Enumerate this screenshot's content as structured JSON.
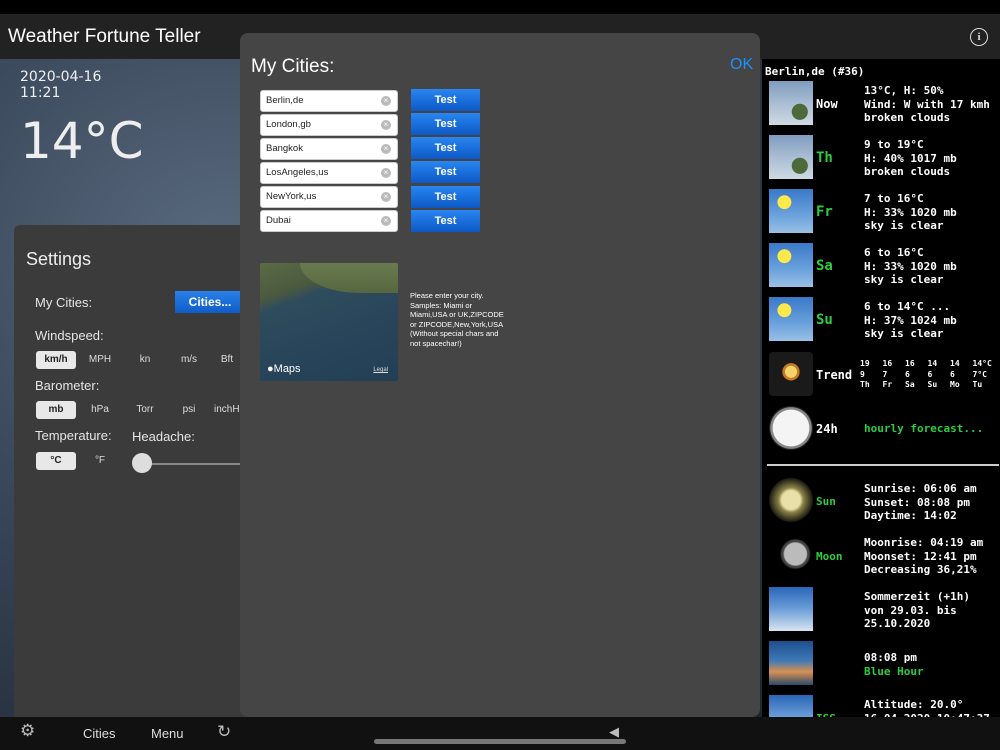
{
  "app": {
    "title": "Weather Fortune Teller"
  },
  "hero": {
    "date": "2020-04-16",
    "time": "11:21",
    "temp": "14°C"
  },
  "settings": {
    "title": "Settings",
    "my_cities_label": "My Cities:",
    "cities_button": "Cities...",
    "windspeed_label": "Windspeed:",
    "windspeed_options": [
      "km/h",
      "MPH",
      "kn",
      "m/s",
      "Bft"
    ],
    "windspeed_selected": "km/h",
    "barometer_label": "Barometer:",
    "barometer_options": [
      "mb",
      "hPa",
      "Torr",
      "psi",
      "inchHg"
    ],
    "barometer_selected": "mb",
    "temperature_label": "Temperature:",
    "temperature_options": [
      "°C",
      "°F"
    ],
    "temperature_selected": "°C",
    "headache_label": "Headache:",
    "headache_value": 0
  },
  "dialog": {
    "title": "My Cities:",
    "ok": "OK",
    "test_label": "Test",
    "cities": [
      "Berlin,de",
      "London,gb",
      "Bangkok",
      "LosAngeles,us",
      "NewYork,us",
      "Dubai"
    ],
    "map_logo": "Maps",
    "map_legal": "Legal",
    "help": "Please enter your city. Samples: Miami or Miami,USA or UK,ZIPCODE or ZIPCODE,New,York,USA (Without special chars and not spacechar!)"
  },
  "forecast": {
    "city": "Berlin,de (#36)",
    "rows": [
      {
        "label": "Now",
        "label_color": "#ffffff",
        "text": "13°C, H: 50%\nWind: W with 17 kmh\nbroken clouds",
        "icon": "cloud-icon"
      },
      {
        "label": "Th",
        "label_color": "#2ecc40",
        "text": "9 to 19°C\nH: 40% 1017 mb\nbroken clouds",
        "icon": "cloud-icon"
      },
      {
        "label": "Fr",
        "label_color": "#2ecc40",
        "text": "7 to 16°C\nH: 33% 1020 mb\nsky is clear",
        "icon": "sun-icon"
      },
      {
        "label": "Sa",
        "label_color": "#2ecc40",
        "text": "6 to 16°C\nH: 33% 1020 mb\nsky is clear",
        "icon": "sun-icon"
      },
      {
        "label": "Su",
        "label_color": "#2ecc40",
        "text": "6 to 14°C ...\nH: 37% 1024 mb\nsky is clear",
        "icon": "sun-icon"
      }
    ],
    "trend": {
      "label": "Trend",
      "highs": [
        "19",
        "16",
        "16",
        "14",
        "14",
        "14°C"
      ],
      "lows": [
        "9",
        "7",
        "6",
        "6",
        "6",
        "7°C"
      ],
      "days": [
        "Th",
        "Fr",
        "Sa",
        "Su",
        "Mo",
        "Tu"
      ]
    },
    "hourly": {
      "label": "24h",
      "text": "hourly forecast..."
    },
    "sun": {
      "label": "Sun",
      "text": "Sunrise: 06:06 am\nSunset: 08:08 pm\nDaytime: 14:02"
    },
    "moon": {
      "label": "Moon",
      "text": "Moonrise: 04:19 am\nMoonset: 12:41 pm\nDecreasing 36,21%"
    },
    "dst": {
      "text": "Sommerzeit (+1h)\nvon 29.03. bis\n25.10.2020"
    },
    "bluehour": {
      "time": "08:08 pm",
      "label": "Blue Hour"
    },
    "altitude": {
      "label": "ISS",
      "text": "Altitude: 20.0°\n16.04.2020 10:47:37"
    }
  },
  "bottom": {
    "cities": "Cities",
    "menu": "Menu"
  },
  "colors": {
    "accent": "#1e90ff",
    "green": "#2ecc40",
    "button_blue": "#1a6fdc"
  }
}
